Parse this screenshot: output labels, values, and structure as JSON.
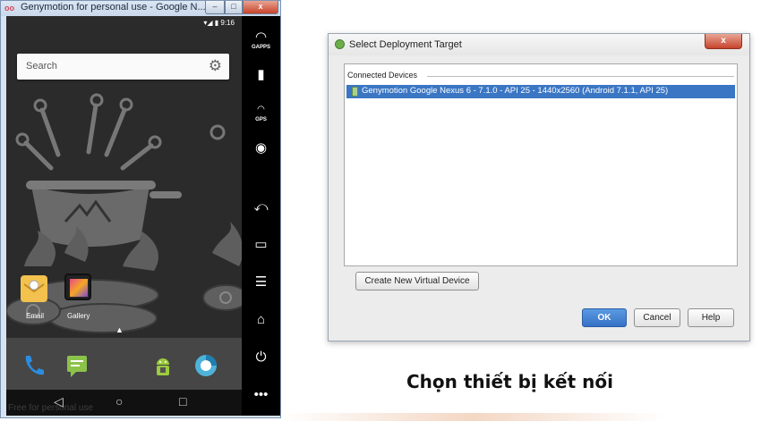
{
  "genymotion": {
    "window_title": "Genymotion for personal use - Google N...",
    "logo_text": "oo",
    "close_glyph": "x",
    "min_glyph": "–",
    "max_glyph": "□",
    "status_text": "9:16",
    "status_icons": "▾◢ ▮",
    "search_label": "Search",
    "apps": [
      {
        "label": "Email"
      },
      {
        "label": "Gallery"
      }
    ],
    "watermark": "Free for personal use",
    "nav": {
      "back": "◁",
      "home": "○",
      "recents": "□"
    },
    "side_panel": {
      "gapps_label": "GAPPS",
      "gps_label": "GPS",
      "more": "•••"
    }
  },
  "dialog": {
    "title": "Select Deployment Target",
    "close_glyph": "x",
    "group_header": "Connected Devices",
    "device": "Genymotion Google Nexus 6 - 7.1.0 - API 25 - 1440x2560 (Android 7.1.1, API 25)",
    "create_button": "Create New Virtual Device",
    "ok_button": "OK",
    "cancel_button": "Cancel",
    "help_button": "Help"
  },
  "caption": "Chọn thiết bị kết nối",
  "colors": {
    "selection": "#3a76c4",
    "ok_button": "#3571c5",
    "phone_bg": "#2b2b2b"
  }
}
